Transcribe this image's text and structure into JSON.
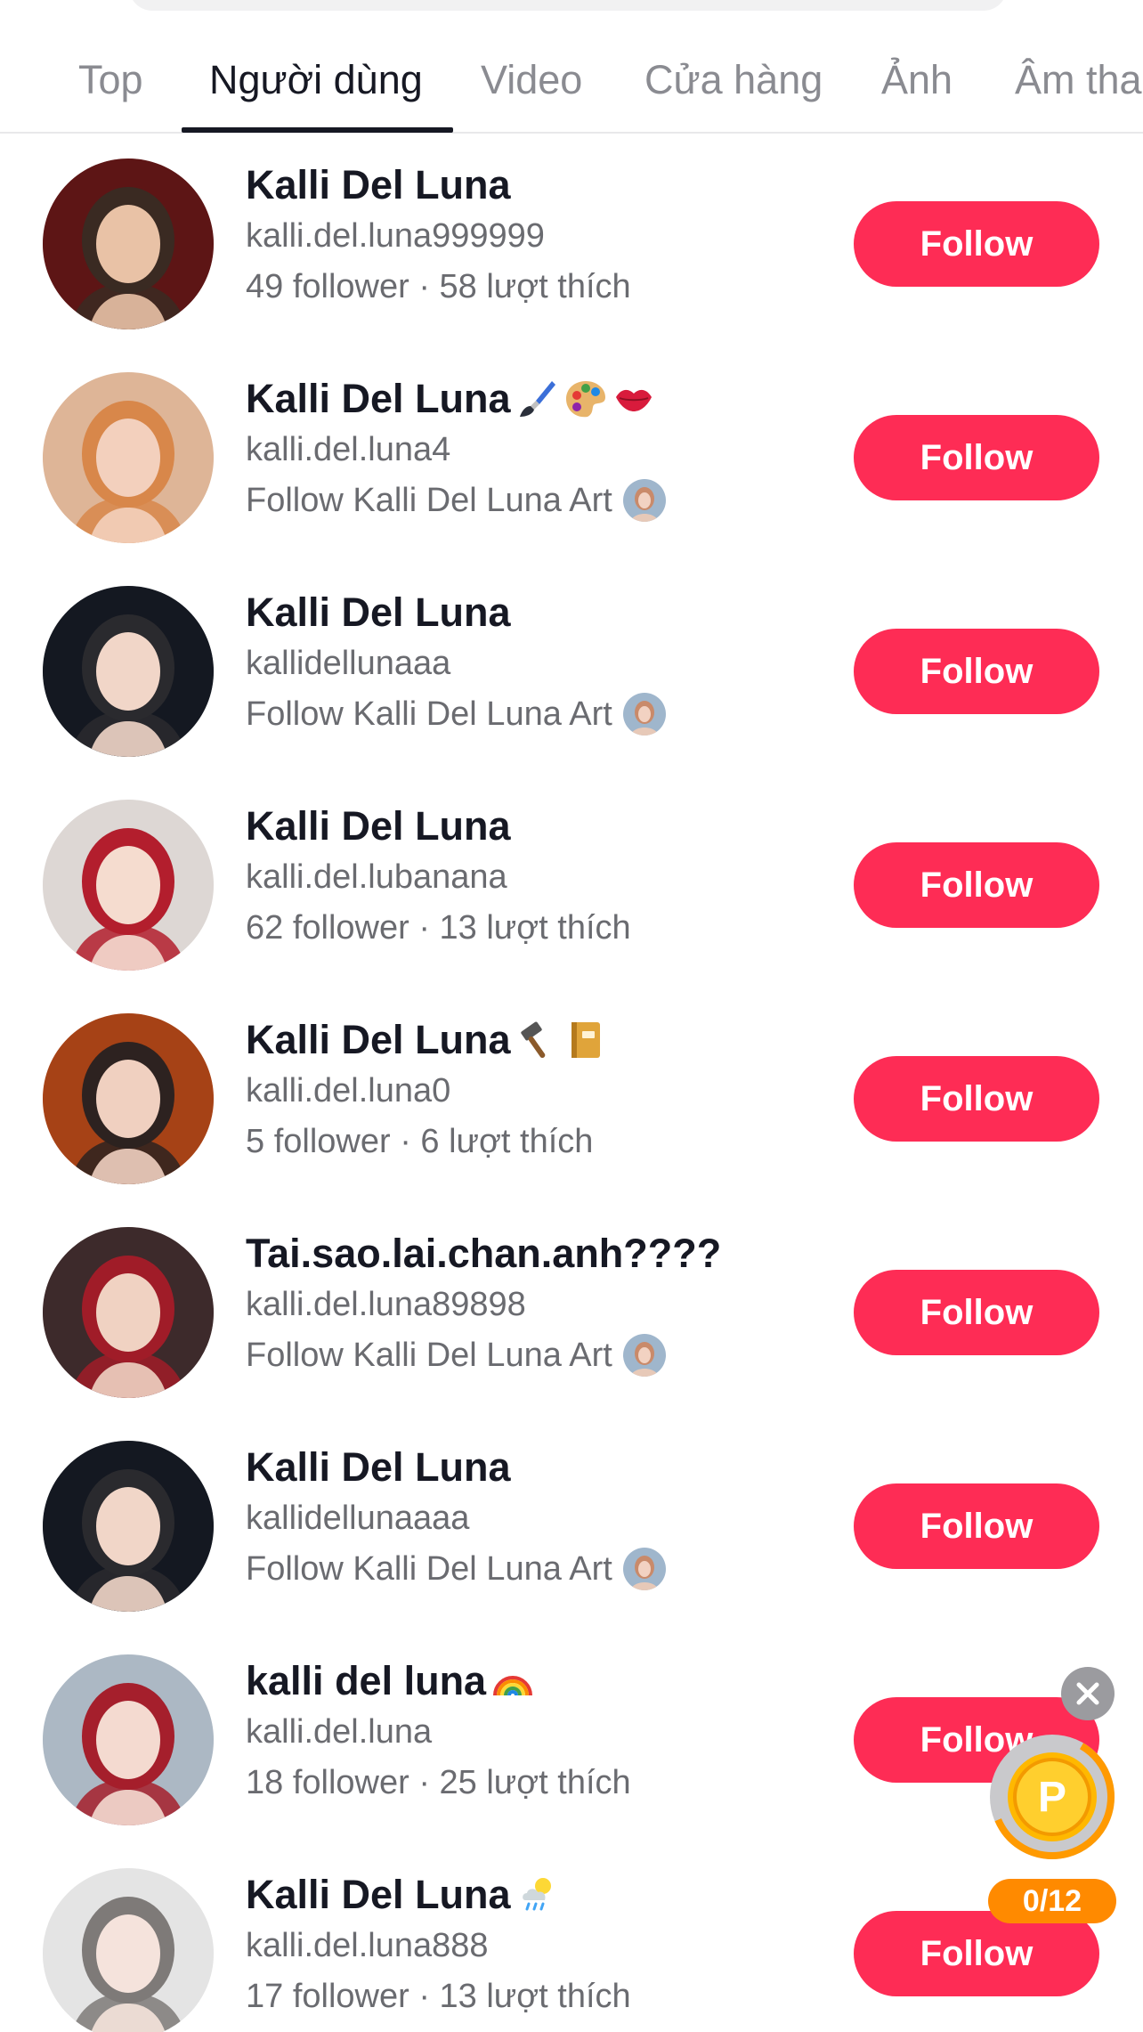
{
  "tabs": [
    {
      "label": "Top",
      "active": false
    },
    {
      "label": "Người dùng",
      "active": true
    },
    {
      "label": "Video",
      "active": false
    },
    {
      "label": "Cửa hàng",
      "active": false
    },
    {
      "label": "Ảnh",
      "active": false
    },
    {
      "label": "Âm tha",
      "active": false
    }
  ],
  "users": [
    {
      "name": "Kalli Del Luna",
      "emojis": [],
      "handle": "kalli.del.luna999999",
      "meta": "49 follower · 58 lượt thích",
      "meta_has_avatar": false,
      "follow_label": "Follow"
    },
    {
      "name": "Kalli Del Luna",
      "emojis": [
        "paintbrush",
        "palette",
        "kiss"
      ],
      "handle": "kalli.del.luna4",
      "meta": "Follow Kalli Del Luna Art",
      "meta_has_avatar": true,
      "follow_label": "Follow"
    },
    {
      "name": "Kalli Del Luna",
      "emojis": [],
      "handle": "kallidellunaaa",
      "meta": "Follow Kalli Del Luna Art",
      "meta_has_avatar": true,
      "follow_label": "Follow"
    },
    {
      "name": "Kalli Del Luna",
      "emojis": [],
      "handle": "kalli.del.lubanana",
      "meta": "62 follower · 13 lượt thích",
      "meta_has_avatar": false,
      "follow_label": "Follow"
    },
    {
      "name": "Kalli Del Luna",
      "emojis": [
        "hammer",
        "notebook"
      ],
      "handle": "kalli.del.luna0",
      "meta": "5 follower · 6 lượt thích",
      "meta_has_avatar": false,
      "follow_label": "Follow"
    },
    {
      "name": "Tai.sao.lai.chan.anh????",
      "emojis": [],
      "handle": "kalli.del.luna89898",
      "meta": "Follow Kalli Del Luna Art",
      "meta_has_avatar": true,
      "follow_label": "Follow"
    },
    {
      "name": "Kalli Del Luna",
      "emojis": [],
      "handle": "kallidellunaaaa",
      "meta": "Follow Kalli Del Luna Art",
      "meta_has_avatar": true,
      "follow_label": "Follow"
    },
    {
      "name": "kalli del luna",
      "emojis": [
        "rainbow"
      ],
      "handle": "kalli.del.luna",
      "meta": "18 follower · 25 lượt thích",
      "meta_has_avatar": false,
      "follow_label": "Follow"
    },
    {
      "name": "Kalli Del Luna",
      "emojis": [
        "sun-rain-cloud"
      ],
      "handle": "kalli.del.luna888",
      "meta": "17 follower · 13 lượt thích",
      "meta_has_avatar": false,
      "follow_label": "Follow"
    }
  ],
  "reward": {
    "coin_letter": "P",
    "progress_text": "0/12"
  },
  "colors": {
    "accent": "#fe2c55",
    "text_primary": "#161823",
    "text_secondary": "#6a6b70",
    "reward_orange": "#ff8a00"
  }
}
